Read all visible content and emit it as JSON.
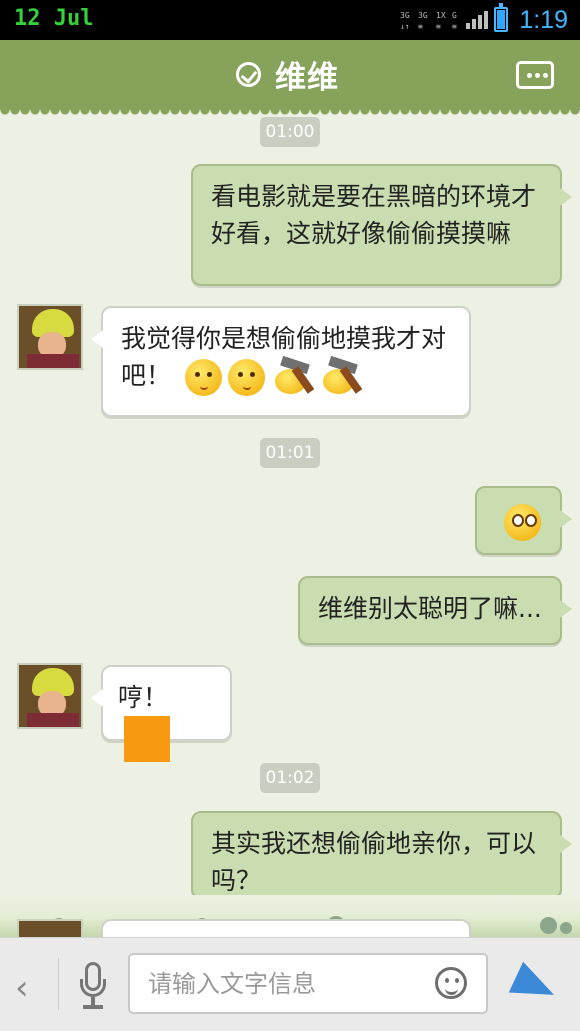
{
  "status": {
    "date": "12 Jul",
    "time": "1:19"
  },
  "topbar": {
    "title": "维维"
  },
  "messages": [
    {
      "time": "01:00"
    },
    {
      "text": "看电影就是要在黑暗的环境才好看，这就好像偷偷摸摸嘛"
    },
    {
      "text": "我觉得你是想偷偷地摸我才对吧！"
    },
    {
      "time": "01:01"
    },
    {
      "text": "维维别太聪明了嘛..."
    },
    {
      "text": "哼！"
    },
    {
      "time": "01:02"
    },
    {
      "text": "其实我还想偷偷地亲你，可以吗？"
    }
  ],
  "input": {
    "placeholder": "请输入文字信息"
  }
}
